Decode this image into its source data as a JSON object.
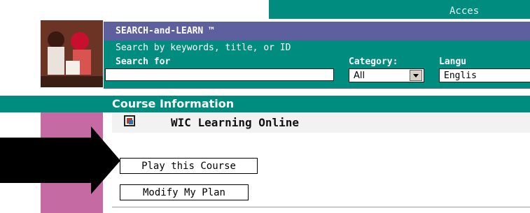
{
  "top_bar": {
    "access_label": "Acces"
  },
  "search": {
    "title": "SEARCH-and-LEARN ™",
    "hint": "Search by keywords, title, or ID",
    "search_for_label": "Search for",
    "search_value": "",
    "category_label": "Category:",
    "category_value": "All",
    "language_label": "Langu",
    "language_value": "Englis"
  },
  "course": {
    "header": "Course Information",
    "title": "WIC Learning Online",
    "icon": "course-file-icon"
  },
  "actions": {
    "play_label": "Play this Course",
    "modify_label": "Modify My Plan"
  },
  "colors": {
    "teal": "#008c7e",
    "purple": "#5e5f9f",
    "pink": "#c66aa3"
  }
}
